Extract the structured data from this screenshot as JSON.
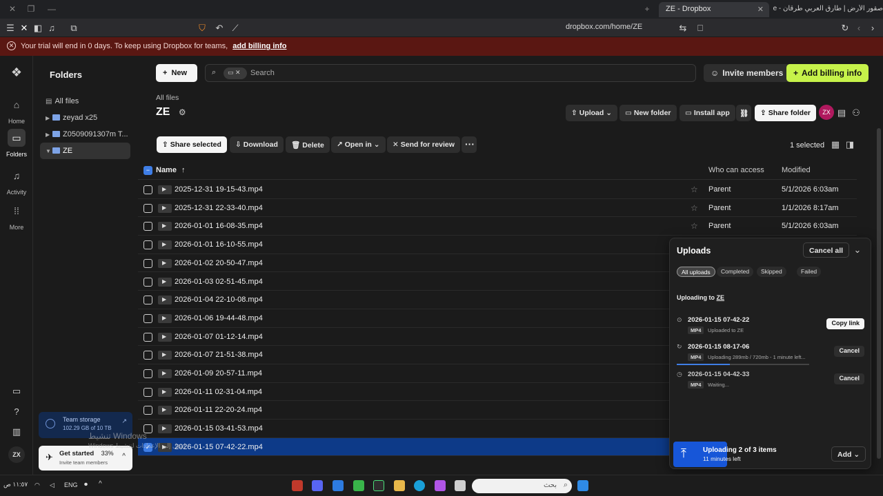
{
  "browser": {
    "active_tab": "ZE - Dropbox",
    "other_tab": "صقور الأرض | طارق العربي طرقان - e",
    "url": "dropbox.com/home/ZE"
  },
  "banner": {
    "text": "Your trial will end in 0 days. To keep using Dropbox for teams,",
    "link": "add billing info"
  },
  "rail": {
    "items": [
      {
        "label": "Home",
        "icon": "home-icon"
      },
      {
        "label": "Folders",
        "icon": "folder-icon"
      },
      {
        "label": "Activity",
        "icon": "bell-icon"
      },
      {
        "label": "More",
        "icon": "grid-icon"
      }
    ],
    "avatar": "ZX"
  },
  "tree": {
    "title": "Folders",
    "all_files": "All files",
    "folders": [
      "zeyad x25",
      "Z0509091307m T...",
      "ZE"
    ],
    "storage_title": "Team storage",
    "storage_sub": "102.29 GB of 10 TB",
    "get_started": "Get started",
    "get_started_pct": "33%",
    "get_started_sub": "Invite team members"
  },
  "toolbar": {
    "new_label": "New",
    "search_placeholder": "Search",
    "invite_label": "Invite members",
    "add_billing_label": "Add billing info"
  },
  "folder": {
    "crumb": "All files",
    "title": "ZE",
    "upload": "Upload",
    "new_folder": "New folder",
    "install_app": "Install app",
    "share_folder": "Share folder",
    "avatar": "ZX"
  },
  "actions": {
    "share_selected": "Share selected",
    "download": "Download",
    "delete": "Delete",
    "open_in": "Open in",
    "send_for_review": "Send for review",
    "selected_count": "1 selected"
  },
  "table": {
    "headers": {
      "name": "Name",
      "access": "Who can access",
      "modified": "Modified"
    },
    "rows": [
      {
        "name": "2025-12-31 19-15-43.mp4",
        "access": "Parent",
        "modified": "5/1/2026 6:03am",
        "selected": false
      },
      {
        "name": "2025-12-31 22-33-40.mp4",
        "access": "Parent",
        "modified": "1/1/2026 8:17am",
        "selected": false
      },
      {
        "name": "2026-01-01 16-08-35.mp4",
        "access": "Parent",
        "modified": "5/1/2026 6:03am",
        "selected": false
      },
      {
        "name": "2026-01-01 16-10-55.mp4",
        "access": "",
        "modified": "",
        "selected": false
      },
      {
        "name": "2026-01-02 20-50-47.mp4",
        "access": "",
        "modified": "",
        "selected": false
      },
      {
        "name": "2026-01-03 02-51-45.mp4",
        "access": "",
        "modified": "",
        "selected": false
      },
      {
        "name": "2026-01-04 22-10-08.mp4",
        "access": "",
        "modified": "",
        "selected": false
      },
      {
        "name": "2026-01-06 19-44-48.mp4",
        "access": "",
        "modified": "",
        "selected": false
      },
      {
        "name": "2026-01-07 01-12-14.mp4",
        "access": "",
        "modified": "",
        "selected": false
      },
      {
        "name": "2026-01-07 21-51-38.mp4",
        "access": "",
        "modified": "",
        "selected": false
      },
      {
        "name": "2026-01-09 20-57-11.mp4",
        "access": "",
        "modified": "",
        "selected": false
      },
      {
        "name": "2026-01-11 02-31-04.mp4",
        "access": "",
        "modified": "",
        "selected": false
      },
      {
        "name": "2026-01-11 22-20-24.mp4",
        "access": "",
        "modified": "",
        "selected": false
      },
      {
        "name": "2026-01-15 03-41-53.mp4",
        "access": "",
        "modified": "",
        "selected": false
      },
      {
        "name": "2026-01-15 07-42-22.mp4",
        "access": "",
        "modified": "",
        "selected": true
      }
    ]
  },
  "uploads": {
    "title": "Uploads",
    "cancel_all": "Cancel all",
    "filters": [
      "All uploads",
      "Completed",
      "Skipped",
      "Failed"
    ],
    "uploading_to": "Uploading to",
    "uploading_to_folder": "ZE",
    "items": [
      {
        "name": "2026-01-15 07-42-22",
        "badge": "MP4",
        "status": "Uploaded to ZE",
        "action": "Copy link",
        "progress": 1.0
      },
      {
        "name": "2026-01-15 08-17-06",
        "badge": "MP4",
        "status": "Uploading 289mb / 720mb - 1 minute left...",
        "action": "Cancel",
        "progress": 0.4
      },
      {
        "name": "2026-01-15 04-42-33",
        "badge": "MP4",
        "status": "Waiting...",
        "action": "Cancel",
        "progress": 0
      }
    ],
    "footer_title": "Uploading 2 of 3 items",
    "footer_sub": "11 minutes left",
    "add_label": "Add"
  },
  "watermark": {
    "line1": "تنشيط Windows",
    "line2": "Windows انتقل إلى الإعدادات لتنشيط"
  },
  "taskbar": {
    "lang": "ENG",
    "search_placeholder": "بحث",
    "clock": "١١:٥٧ ص"
  },
  "colors": {
    "accent_lime": "#c6f24a",
    "selection_blue": "#0d3a88",
    "banner_red": "#5a1712"
  }
}
